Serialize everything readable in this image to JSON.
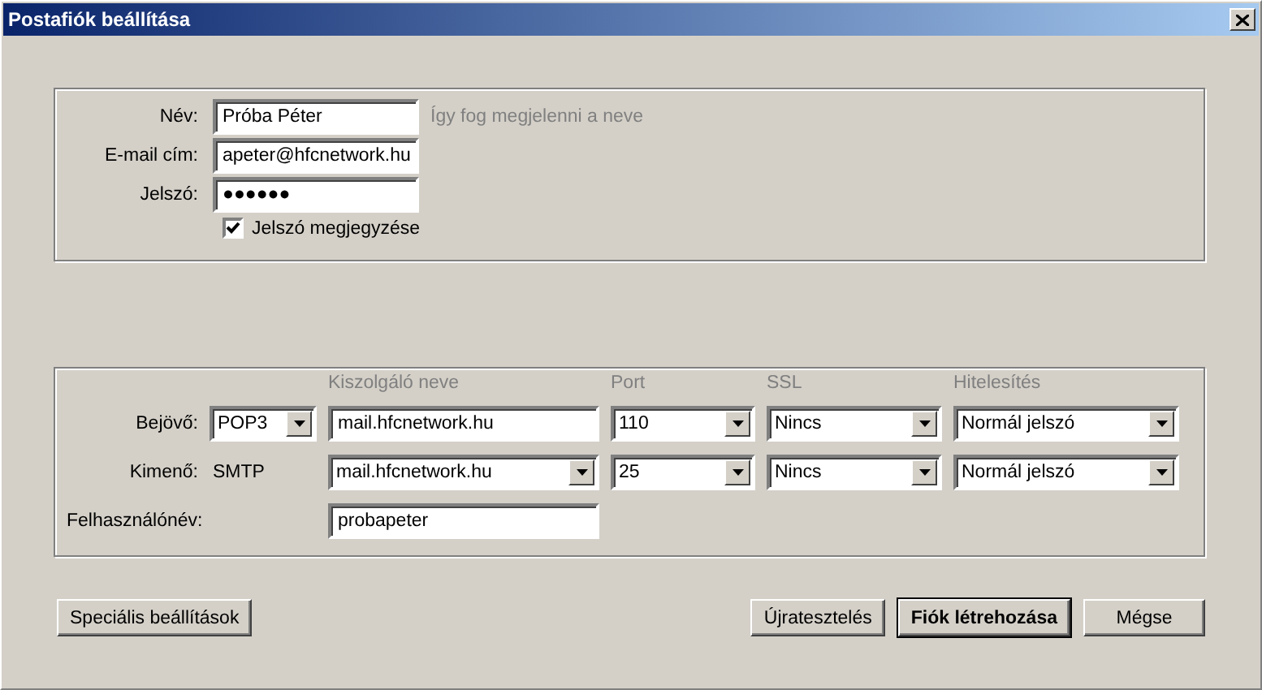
{
  "window": {
    "title": "Postafiók beállítása"
  },
  "account": {
    "fields": [
      {
        "label": "Név:",
        "value": "Próba Péter",
        "hint": "Így fog megjelenni a neve"
      },
      {
        "label": "E-mail cím:",
        "value": "apeter@hfcnetwork.hu"
      },
      {
        "label": "Jelszó:",
        "value": "●●●●●●"
      }
    ],
    "remember": {
      "label": "Jelszó megjegyzése",
      "checked": true
    }
  },
  "servers": {
    "columns": [
      "Kiszolgáló neve",
      "Port",
      "SSL",
      "Hitelesítés"
    ],
    "rows": [
      {
        "label": "Bejövő:",
        "protocol": {
          "kind": "select",
          "value": "POP3"
        },
        "server": {
          "kind": "text",
          "value": "mail.hfcnetwork.hu"
        },
        "port": "110",
        "ssl": "Nincs",
        "auth": "Normál jelszó"
      },
      {
        "label": "Kimenő:",
        "protocol": {
          "kind": "static",
          "value": "SMTP"
        },
        "server": {
          "kind": "select",
          "value": "mail.hfcnetwork.hu"
        },
        "port": "25",
        "ssl": "Nincs",
        "auth": "Normál jelszó"
      }
    ],
    "username": {
      "label": "Felhasználónév:",
      "value": "probapeter"
    }
  },
  "buttons_left": [
    {
      "label": "Speciális beállítások",
      "default": false
    }
  ],
  "buttons_right": [
    {
      "label": "Újratesztelés",
      "default": false
    },
    {
      "label": "Fiók létrehozása",
      "default": true
    },
    {
      "label": "Mégse",
      "default": false
    }
  ]
}
